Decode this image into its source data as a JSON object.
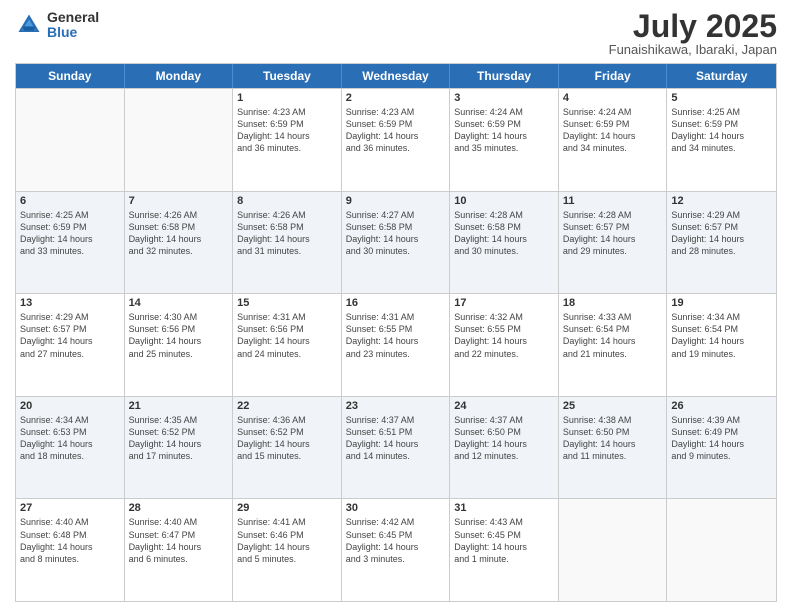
{
  "logo": {
    "general": "General",
    "blue": "Blue"
  },
  "title": "July 2025",
  "location": "Funaishikawa, Ibaraki, Japan",
  "weekdays": [
    "Sunday",
    "Monday",
    "Tuesday",
    "Wednesday",
    "Thursday",
    "Friday",
    "Saturday"
  ],
  "rows": [
    [
      {
        "day": "",
        "info": ""
      },
      {
        "day": "",
        "info": ""
      },
      {
        "day": "1",
        "info": "Sunrise: 4:23 AM\nSunset: 6:59 PM\nDaylight: 14 hours\nand 36 minutes."
      },
      {
        "day": "2",
        "info": "Sunrise: 4:23 AM\nSunset: 6:59 PM\nDaylight: 14 hours\nand 36 minutes."
      },
      {
        "day": "3",
        "info": "Sunrise: 4:24 AM\nSunset: 6:59 PM\nDaylight: 14 hours\nand 35 minutes."
      },
      {
        "day": "4",
        "info": "Sunrise: 4:24 AM\nSunset: 6:59 PM\nDaylight: 14 hours\nand 34 minutes."
      },
      {
        "day": "5",
        "info": "Sunrise: 4:25 AM\nSunset: 6:59 PM\nDaylight: 14 hours\nand 34 minutes."
      }
    ],
    [
      {
        "day": "6",
        "info": "Sunrise: 4:25 AM\nSunset: 6:59 PM\nDaylight: 14 hours\nand 33 minutes."
      },
      {
        "day": "7",
        "info": "Sunrise: 4:26 AM\nSunset: 6:58 PM\nDaylight: 14 hours\nand 32 minutes."
      },
      {
        "day": "8",
        "info": "Sunrise: 4:26 AM\nSunset: 6:58 PM\nDaylight: 14 hours\nand 31 minutes."
      },
      {
        "day": "9",
        "info": "Sunrise: 4:27 AM\nSunset: 6:58 PM\nDaylight: 14 hours\nand 30 minutes."
      },
      {
        "day": "10",
        "info": "Sunrise: 4:28 AM\nSunset: 6:58 PM\nDaylight: 14 hours\nand 30 minutes."
      },
      {
        "day": "11",
        "info": "Sunrise: 4:28 AM\nSunset: 6:57 PM\nDaylight: 14 hours\nand 29 minutes."
      },
      {
        "day": "12",
        "info": "Sunrise: 4:29 AM\nSunset: 6:57 PM\nDaylight: 14 hours\nand 28 minutes."
      }
    ],
    [
      {
        "day": "13",
        "info": "Sunrise: 4:29 AM\nSunset: 6:57 PM\nDaylight: 14 hours\nand 27 minutes."
      },
      {
        "day": "14",
        "info": "Sunrise: 4:30 AM\nSunset: 6:56 PM\nDaylight: 14 hours\nand 25 minutes."
      },
      {
        "day": "15",
        "info": "Sunrise: 4:31 AM\nSunset: 6:56 PM\nDaylight: 14 hours\nand 24 minutes."
      },
      {
        "day": "16",
        "info": "Sunrise: 4:31 AM\nSunset: 6:55 PM\nDaylight: 14 hours\nand 23 minutes."
      },
      {
        "day": "17",
        "info": "Sunrise: 4:32 AM\nSunset: 6:55 PM\nDaylight: 14 hours\nand 22 minutes."
      },
      {
        "day": "18",
        "info": "Sunrise: 4:33 AM\nSunset: 6:54 PM\nDaylight: 14 hours\nand 21 minutes."
      },
      {
        "day": "19",
        "info": "Sunrise: 4:34 AM\nSunset: 6:54 PM\nDaylight: 14 hours\nand 19 minutes."
      }
    ],
    [
      {
        "day": "20",
        "info": "Sunrise: 4:34 AM\nSunset: 6:53 PM\nDaylight: 14 hours\nand 18 minutes."
      },
      {
        "day": "21",
        "info": "Sunrise: 4:35 AM\nSunset: 6:52 PM\nDaylight: 14 hours\nand 17 minutes."
      },
      {
        "day": "22",
        "info": "Sunrise: 4:36 AM\nSunset: 6:52 PM\nDaylight: 14 hours\nand 15 minutes."
      },
      {
        "day": "23",
        "info": "Sunrise: 4:37 AM\nSunset: 6:51 PM\nDaylight: 14 hours\nand 14 minutes."
      },
      {
        "day": "24",
        "info": "Sunrise: 4:37 AM\nSunset: 6:50 PM\nDaylight: 14 hours\nand 12 minutes."
      },
      {
        "day": "25",
        "info": "Sunrise: 4:38 AM\nSunset: 6:50 PM\nDaylight: 14 hours\nand 11 minutes."
      },
      {
        "day": "26",
        "info": "Sunrise: 4:39 AM\nSunset: 6:49 PM\nDaylight: 14 hours\nand 9 minutes."
      }
    ],
    [
      {
        "day": "27",
        "info": "Sunrise: 4:40 AM\nSunset: 6:48 PM\nDaylight: 14 hours\nand 8 minutes."
      },
      {
        "day": "28",
        "info": "Sunrise: 4:40 AM\nSunset: 6:47 PM\nDaylight: 14 hours\nand 6 minutes."
      },
      {
        "day": "29",
        "info": "Sunrise: 4:41 AM\nSunset: 6:46 PM\nDaylight: 14 hours\nand 5 minutes."
      },
      {
        "day": "30",
        "info": "Sunrise: 4:42 AM\nSunset: 6:45 PM\nDaylight: 14 hours\nand 3 minutes."
      },
      {
        "day": "31",
        "info": "Sunrise: 4:43 AM\nSunset: 6:45 PM\nDaylight: 14 hours\nand 1 minute."
      },
      {
        "day": "",
        "info": ""
      },
      {
        "day": "",
        "info": ""
      }
    ]
  ]
}
